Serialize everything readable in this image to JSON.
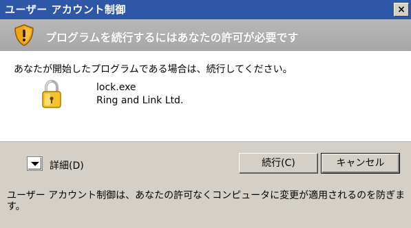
{
  "window": {
    "title": "ユーザー アカウント制御",
    "close_label": "×"
  },
  "banner": {
    "icon": "uac-shield-icon",
    "text": "プログラムを続行するにはあなたの許可が必要です"
  },
  "body": {
    "instruction": "あなたが開始したプログラムである場合は、続行してください。",
    "program": {
      "icon": "lock-icon",
      "name": "lock.exe",
      "publisher": "Ring and Link Ltd."
    }
  },
  "actions": {
    "details_label": "詳細(D)",
    "continue_label": "続行(C)",
    "cancel_label": "キャンセル"
  },
  "footer": {
    "text": "ユーザー アカウント制御は、あなたの許可なくコンピュータに変更が適用されるのを防ぎます。"
  }
}
